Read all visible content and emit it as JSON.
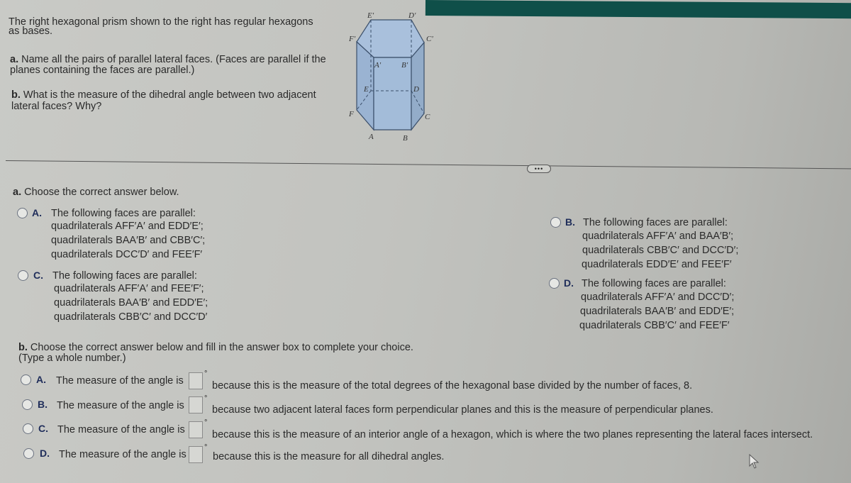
{
  "question": {
    "intro": "The right hexagonal prism shown to the right has regular hexagons",
    "intro_line2": "as bases.",
    "part_a_label": "a.",
    "part_a_text": "Name all the pairs of parallel lateral faces. (Faces are parallel if the",
    "part_a_text2": "planes containing the faces are parallel.)",
    "part_b_label": "b.",
    "part_b_text": "What is the measure of the dihedral angle between two adjacent",
    "part_b_text2": "lateral faces? Why?"
  },
  "figure": {
    "vertex_labels": {
      "E_prime": "E'",
      "D_prime": "D'",
      "F_prime": "F'",
      "C_prime": "C'",
      "A_prime": "A'",
      "B_prime": "B'",
      "E": "E",
      "D": "D",
      "F": "F",
      "C": "C",
      "A": "A",
      "B": "B"
    },
    "face_color": "#9fb8d6",
    "edge_color": "#3b4f6a"
  },
  "more_button_label": "•••",
  "part_a": {
    "prompt_label": "a.",
    "prompt": "Choose the correct answer below.",
    "options": [
      {
        "letter": "A.",
        "heading": "The following faces are parallel:",
        "lines": [
          "quadrilaterals AFF′A′ and EDD′E′;",
          "quadrilaterals BAA′B′ and CBB′C′;",
          "quadrilaterals DCC′D′ and FEE′F′"
        ]
      },
      {
        "letter": "B.",
        "heading": "The following faces are parallel:",
        "lines": [
          "quadrilaterals AFF′A′ and BAA′B′;",
          "quadrilaterals CBB′C′ and DCC′D′;",
          "quadrilaterals EDD′E′ and FEE′F′"
        ]
      },
      {
        "letter": "C.",
        "heading": "The following faces are parallel:",
        "lines": [
          "quadrilaterals AFF′A′ and FEE′F′;",
          "quadrilaterals BAA′B′ and EDD′E′;",
          "quadrilaterals CBB′C′ and DCC′D′"
        ]
      },
      {
        "letter": "D.",
        "heading": "The following faces are parallel:",
        "lines": [
          "quadrilaterals AFF′A′ and DCC′D′;",
          "quadrilaterals BAA′B′ and EDD′E′;",
          "quadrilaterals CBB′C′ and FEE′F′"
        ]
      }
    ]
  },
  "part_b": {
    "prompt_label": "b.",
    "prompt": "Choose the correct answer below and fill in the answer box to complete your choice.",
    "hint": "(Type a whole number.)",
    "degree_symbol": "°",
    "options": [
      {
        "letter": "A.",
        "prefix": "The measure of the angle is",
        "value": "",
        "reason": "because this is the measure of the total degrees of the hexagonal base divided by the number of faces, 8."
      },
      {
        "letter": "B.",
        "prefix": "The measure of the angle is",
        "value": "",
        "reason": "because two adjacent lateral faces form perpendicular planes and this is the measure of perpendicular planes."
      },
      {
        "letter": "C.",
        "prefix": "The measure of the angle is",
        "value": "",
        "reason": "because this is the measure of an interior angle of a hexagon, which is where the two planes representing the lateral faces intersect."
      },
      {
        "letter": "D.",
        "prefix": "The measure of the angle is",
        "value": "",
        "reason": "because this is the measure for all dihedral angles."
      }
    ]
  },
  "colors": {
    "header_bar": "#0f4f49",
    "option_letter": "#1f2d5a"
  }
}
